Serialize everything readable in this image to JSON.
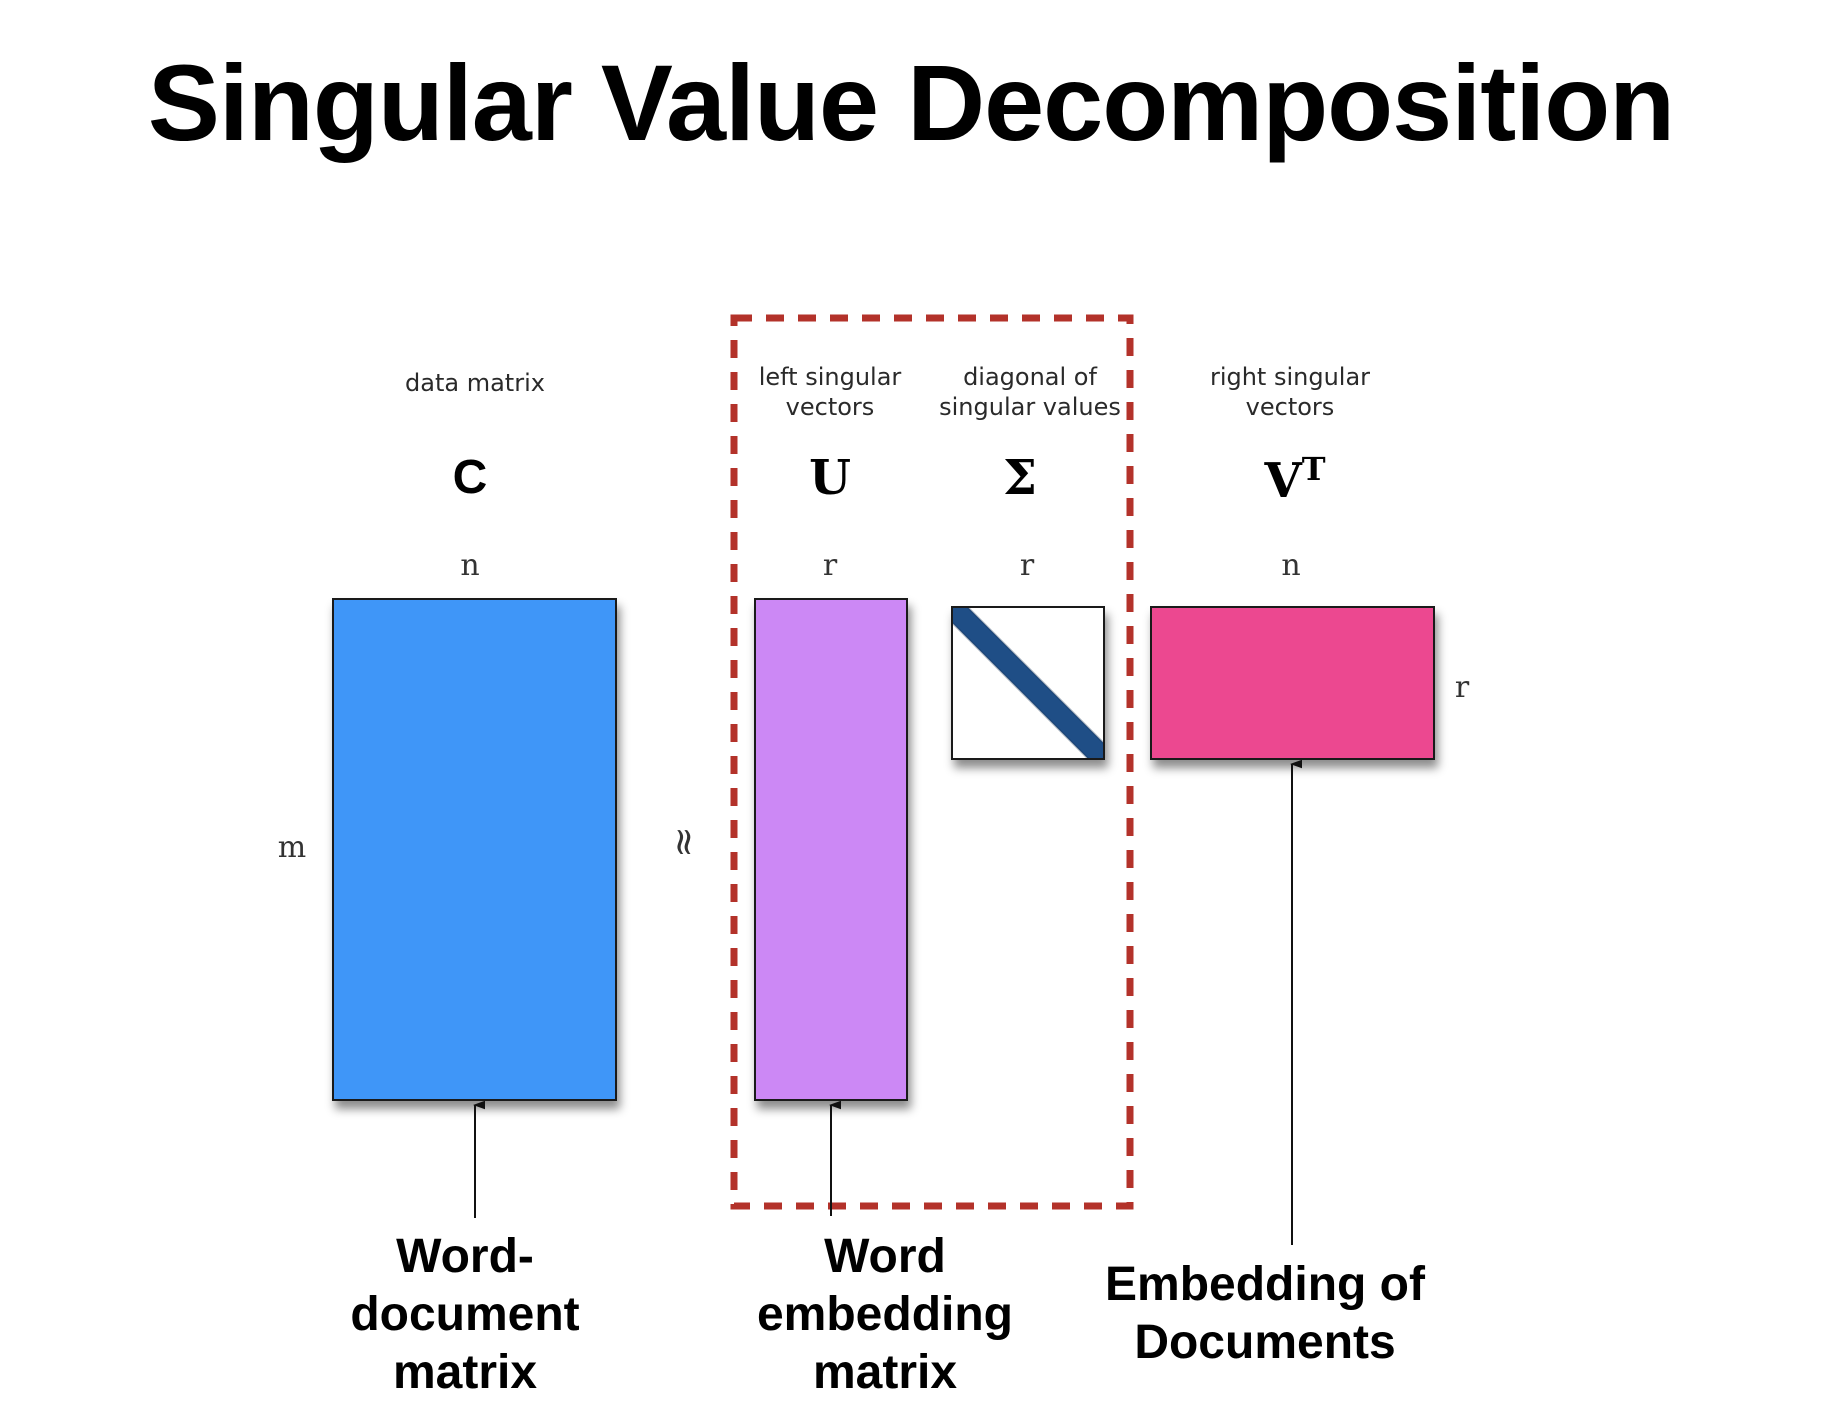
{
  "title": "Singular Value Decomposition",
  "approx_symbol": "≈",
  "matrices": {
    "c": {
      "description": "data matrix",
      "symbol": "C",
      "col_dim": "n",
      "row_dim": "m",
      "color": "#3f96f8"
    },
    "u": {
      "description_line1": "left singular",
      "description_line2": "vectors",
      "symbol": "U",
      "col_dim": "r",
      "color": "#cc88f5"
    },
    "sigma": {
      "description_line1": "diagonal of",
      "description_line2": "singular values",
      "symbol": "Σ",
      "col_dim": "r",
      "diag_color": "#1f4e86"
    },
    "vt": {
      "description_line1": "right singular",
      "description_line2": "vectors",
      "symbol": "V",
      "symbol_sup": "T",
      "col_dim": "n",
      "row_dim": "r",
      "color": "#ec4890"
    }
  },
  "highlight_box_color": "#b3322a",
  "captions": {
    "word_document": {
      "line1": "Word-",
      "line2": "document",
      "line3": "matrix"
    },
    "word_embedding": {
      "line1": "Word",
      "line2": "embedding",
      "line3": "matrix"
    },
    "doc_embedding": {
      "line1": "Embedding of",
      "line2": "Documents"
    }
  }
}
